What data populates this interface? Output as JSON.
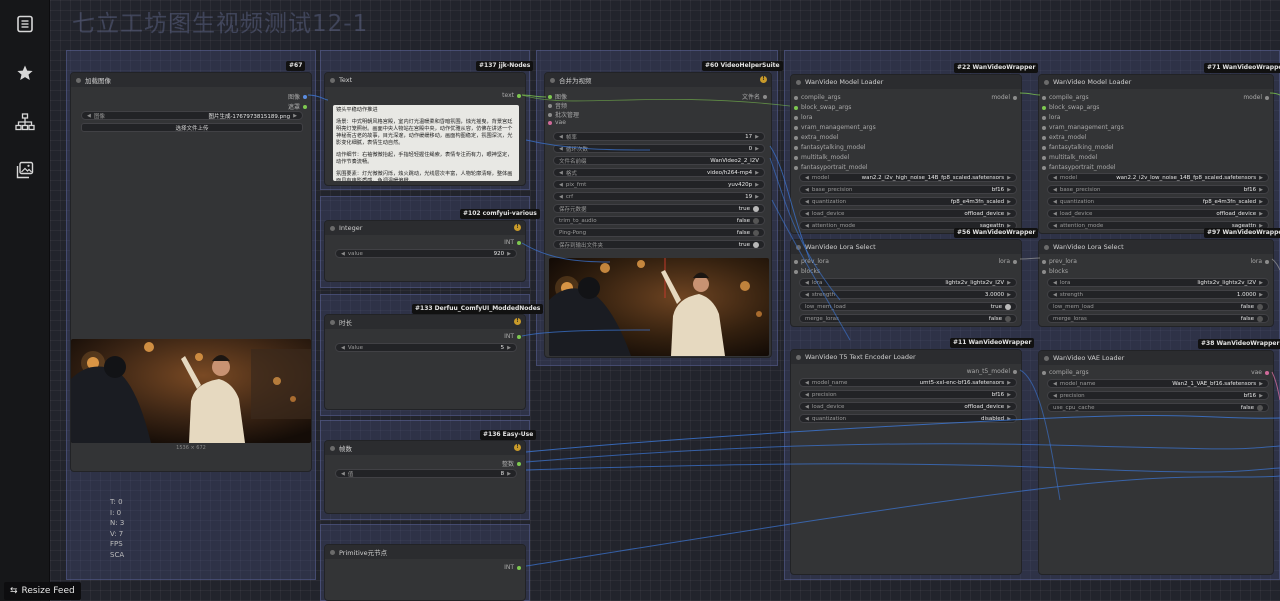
{
  "app": {
    "workflow_title": "七立工坊图生视频测试12-1",
    "resize_feed_label": "Resize Feed",
    "bottom_text": "T: 0\nI: 0\nN: 3\nV: 7\nFPS\nSCA"
  },
  "sidebar": {
    "icons": [
      "queue-icon",
      "star-icon",
      "node-tree-icon",
      "image-gallery-icon"
    ]
  },
  "nodes": {
    "load_image": {
      "badge": "#67",
      "title": "加载图像",
      "outputs": [
        "图像",
        "遮罩"
      ],
      "image_widget_label": "图像",
      "image_widget_value": "图片生成-1767973815189.png",
      "upload_button": "选择文件上传",
      "image_caption": "1536 × 672"
    },
    "text": {
      "badge": "#137 jjk-Nodes",
      "title": "Text",
      "output": "text",
      "paragraphs": [
        "镜头平稳动作推进",
        "场景：中式明朝风格宫殿，室内灯光温暖柔和昏暗氛围，烛光摇曳，背景宫廷明亮灯笼照射。画面中央人物站在宫殿中央，动作优雅从容，仿佛在讲述一个神秘而古老的故事，目光深邃，动作缓缓移动，画面构图稳定，氛围深沉，光影变化细腻，表情生动自然。",
        "动作细节：右袖微微抬起，手指轻轻握住绳索，表情专注而有力，眼神坚定，动作节奏流畅。",
        "氛围要素：灯光微微闪烁，烛火跳动，光线层次丰富，人物轮廓清晰，整体画面具有电影质感，色调温暖偏橙。"
      ]
    },
    "video_combine": {
      "badge": "#60 VideoHelperSuite",
      "title": "合并为视频",
      "inputs": [
        "图像",
        "音频",
        "批次管理",
        "vae"
      ],
      "output": "文件名",
      "widgets": [
        {
          "label": "帧率",
          "value": "17"
        },
        {
          "label": "循环次数",
          "value": "0"
        },
        {
          "label": "文件名前缀",
          "value": "WanVideo2_2_I2V"
        },
        {
          "label": "格式",
          "value": "video/h264-mp4"
        },
        {
          "label": "pix_fmt",
          "value": "yuv420p"
        },
        {
          "label": "crf",
          "value": "19"
        },
        {
          "label": "保存元数据",
          "value": "true"
        },
        {
          "label": "trim_to_audio",
          "value": "false"
        },
        {
          "label": "Ping-Pong",
          "value": "false"
        },
        {
          "label": "保存到输出文件夹",
          "value": "true"
        }
      ]
    },
    "integer": {
      "badge": "#102 comfyui-various",
      "title": "Integer",
      "output": "INT",
      "widget_label": "value",
      "widget_value": "920"
    },
    "duration": {
      "badge": "#133 Derfuu_ComfyUI_ModdedNodes",
      "title": "时长",
      "output": "INT",
      "widget_label": "Value",
      "widget_value": "5"
    },
    "frame_count": {
      "badge": "#136 Easy-Use",
      "title": "帧数",
      "output": "整数",
      "widget_label": "值",
      "widget_value": "8"
    },
    "primitive": {
      "title": "Primitive元节点",
      "output": "INT"
    },
    "model_loader_1": {
      "badge": "#22 WanVideoWrapper",
      "title": "WanVideo Model Loader",
      "inputs": [
        "compile_args",
        "block_swap_args",
        "lora",
        "vram_management_args",
        "extra_model",
        "fantasytalking_model",
        "multitalk_model",
        "fantasyportrait_model"
      ],
      "output": "model",
      "widgets": [
        {
          "label": "model",
          "value": "wan2.2_i2v_high_noise_14B_fp8_scaled.safetensors"
        },
        {
          "label": "base_precision",
          "value": "bf16"
        },
        {
          "label": "quantization",
          "value": "fp8_e4m3fn_scaled"
        },
        {
          "label": "load_device",
          "value": "offload_device"
        },
        {
          "label": "attention_mode",
          "value": "sageattn"
        }
      ]
    },
    "model_loader_2": {
      "badge": "#71 WanVideoWrapper",
      "title": "WanVideo Model Loader",
      "inputs": [
        "compile_args",
        "block_swap_args",
        "lora",
        "vram_management_args",
        "extra_model",
        "fantasytalking_model",
        "multitalk_model",
        "fantasyportrait_model"
      ],
      "output": "model",
      "widgets": [
        {
          "label": "model",
          "value": "wan2.2_i2v_low_noise_14B_fp8_scaled.safetensors"
        },
        {
          "label": "base_precision",
          "value": "bf16"
        },
        {
          "label": "quantization",
          "value": "fp8_e4m3fn_scaled"
        },
        {
          "label": "load_device",
          "value": "offload_device"
        },
        {
          "label": "attention_mode",
          "value": "sageattn"
        }
      ]
    },
    "lora_select_1": {
      "badge": "#56 WanVideoWrapper",
      "title": "WanVideo Lora Select",
      "inputs": [
        "prev_lora",
        "blocks"
      ],
      "output": "lora",
      "widgets": [
        {
          "label": "lora",
          "value": "lightx2v_lightx2v_I2V"
        },
        {
          "label": "strength",
          "value": "3.0000"
        },
        {
          "label": "low_mem_load",
          "value": "true"
        },
        {
          "label": "merge_loras",
          "value": "false"
        }
      ]
    },
    "lora_select_2": {
      "badge": "#97 WanVideoWrapper",
      "title": "WanVideo Lora Select",
      "inputs": [
        "prev_lora",
        "blocks"
      ],
      "output": "lora",
      "widgets": [
        {
          "label": "lora",
          "value": "lightx2v_lightx2v_I2V"
        },
        {
          "label": "strength",
          "value": "1.0000"
        },
        {
          "label": "low_mem_load",
          "value": "false"
        },
        {
          "label": "merge_loras",
          "value": "false"
        }
      ]
    },
    "t5_loader": {
      "badge": "#11 WanVideoWrapper",
      "title": "WanVideo T5 Text Encoder Loader",
      "output": "wan_t5_model",
      "widgets": [
        {
          "label": "model_name",
          "value": "umt5-xxl-enc-bf16.safetensors"
        },
        {
          "label": "precision",
          "value": "bf16"
        },
        {
          "label": "load_device",
          "value": "offload_device"
        },
        {
          "label": "quantization",
          "value": "disabled"
        }
      ]
    },
    "vae_loader": {
      "badge": "#38 WanVideoWrapper",
      "title": "WanVideo VAE Loader",
      "inputs": [
        "compile_args"
      ],
      "output": "vae",
      "widgets": [
        {
          "label": "model_name",
          "value": "Wan2_1_VAE_bf16.safetensors"
        },
        {
          "label": "precision",
          "value": "bf16"
        },
        {
          "label": "use_cpu_cache",
          "value": "false"
        }
      ]
    }
  },
  "colors": {
    "canvas": "#22242c",
    "node": "#333436",
    "group": "#48508a",
    "wire_blue": "#3c78d8",
    "text_area": "#e8e8e4"
  }
}
